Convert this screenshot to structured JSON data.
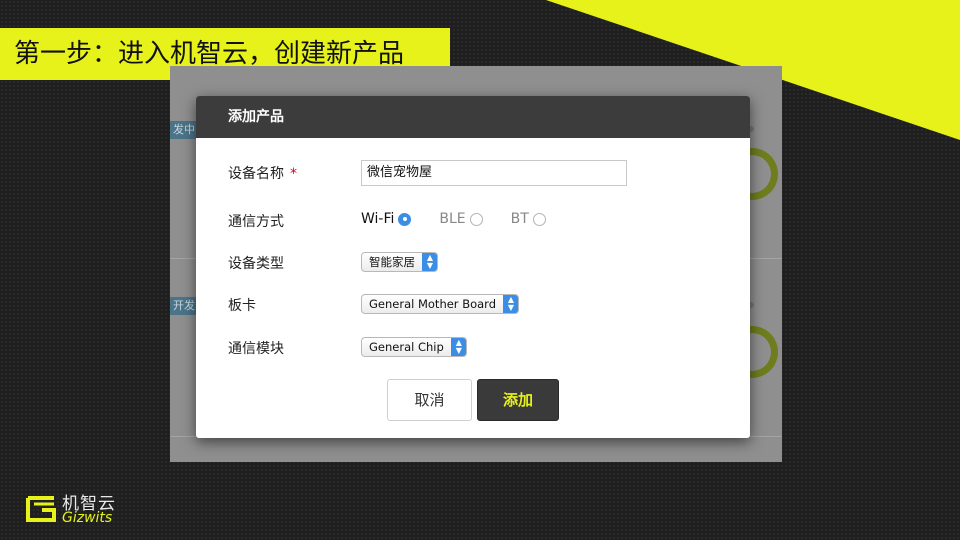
{
  "slide": {
    "title": "第一步：进入机智云，创建新产品"
  },
  "background_screen": {
    "tag_1": "发中",
    "tag_2": "开发"
  },
  "dialog": {
    "title": "添加产品",
    "fields": {
      "device_name_label": "设备名称",
      "required_mark": "*",
      "device_name_value": "微信宠物屋",
      "comm_method_label": "通信方式",
      "device_type_label": "设备类型",
      "board_label": "板卡",
      "comm_module_label": "通信模块"
    },
    "comm_options": {
      "wifi": "Wi-Fi",
      "ble": "BLE",
      "bt": "BT",
      "selected": "Wi-Fi"
    },
    "selects": {
      "device_type": "智能家居",
      "board": "General Mother Board",
      "comm_module": "General Chip"
    },
    "buttons": {
      "cancel": "取消",
      "add": "添加"
    }
  },
  "logo": {
    "name_cn": "机智云",
    "name_en": "Gizwits"
  },
  "colors": {
    "accent": "#e6f21a",
    "dialog_header": "#3c3c3c",
    "radio_selected": "#3a8ee6"
  }
}
